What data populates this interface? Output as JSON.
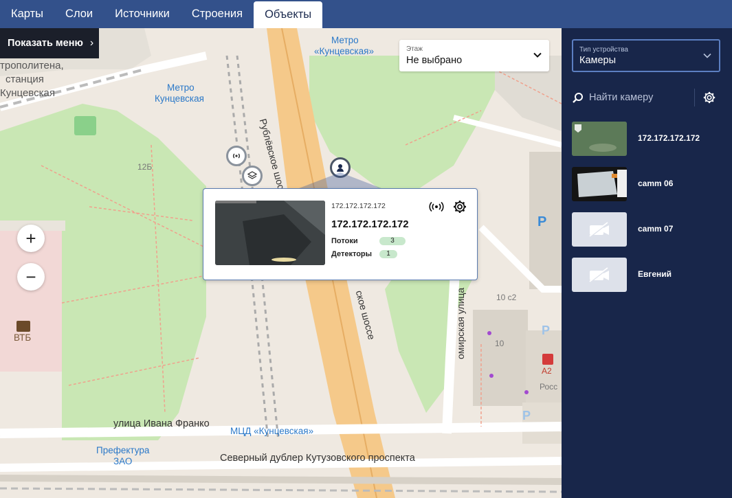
{
  "tabs": [
    {
      "label": "Карты"
    },
    {
      "label": "Слои"
    },
    {
      "label": "Источники"
    },
    {
      "label": "Строения"
    },
    {
      "label": "Объекты"
    }
  ],
  "active_tab": "Объекты",
  "map": {
    "show_menu_label": "Показать меню",
    "floor": {
      "label": "Этаж",
      "value": "Не выбрано"
    },
    "zoom_in": "+",
    "zoom_out": "−",
    "labels": {
      "metro_station": "тро­политена,",
      "metro_station2": "станция",
      "metro_station3": "Кунцевская",
      "metro_kuntsevskaya": "Метро",
      "metro_kuntsevskaya2": "Кунцевская",
      "metro_top": "Метро",
      "metro_top2": "«Кунцевская»",
      "house_12b": "12Б",
      "rublevskoe": "Рублёвское шоссе",
      "rublevskoe2": "ское шоссе",
      "vtb": "ВТБ",
      "ivana_franko": "улица Ивана Франко",
      "mcd": "МЦД «Кунцевская»",
      "prefektura": "Префектура",
      "prefektura2": "ЗАО",
      "severny": "Северный дублер Кутузовского проспекта",
      "mirskaya": "омирская улица",
      "house_10c2": "10 с2",
      "house_10": "10",
      "a2": "А2",
      "ross": "Росс"
    }
  },
  "popup": {
    "subtitle": "172.172.172.172",
    "title": "172.172.172.172",
    "streams_label": "Потоки",
    "streams_count": "3",
    "detectors_label": "Детекторы",
    "detectors_count": "1"
  },
  "sidebar": {
    "device_type": {
      "label": "Тип устройства",
      "value": "Камеры"
    },
    "search_placeholder": "Найти камеру",
    "cameras": [
      {
        "name": "172.172.172.172",
        "thumb": "live-green"
      },
      {
        "name": "camm 06",
        "thumb": "live-dark"
      },
      {
        "name": "camm 07",
        "thumb": "no-video"
      },
      {
        "name": "Евгений",
        "thumb": "no-video"
      }
    ]
  },
  "colors": {
    "topbar": "#33518b",
    "sidebar": "#18264a",
    "accent_border": "#5c7fc2",
    "badge_green": "#c8e8cc",
    "map_green": "#c9e7b4",
    "road_orange": "#f5c98a"
  }
}
